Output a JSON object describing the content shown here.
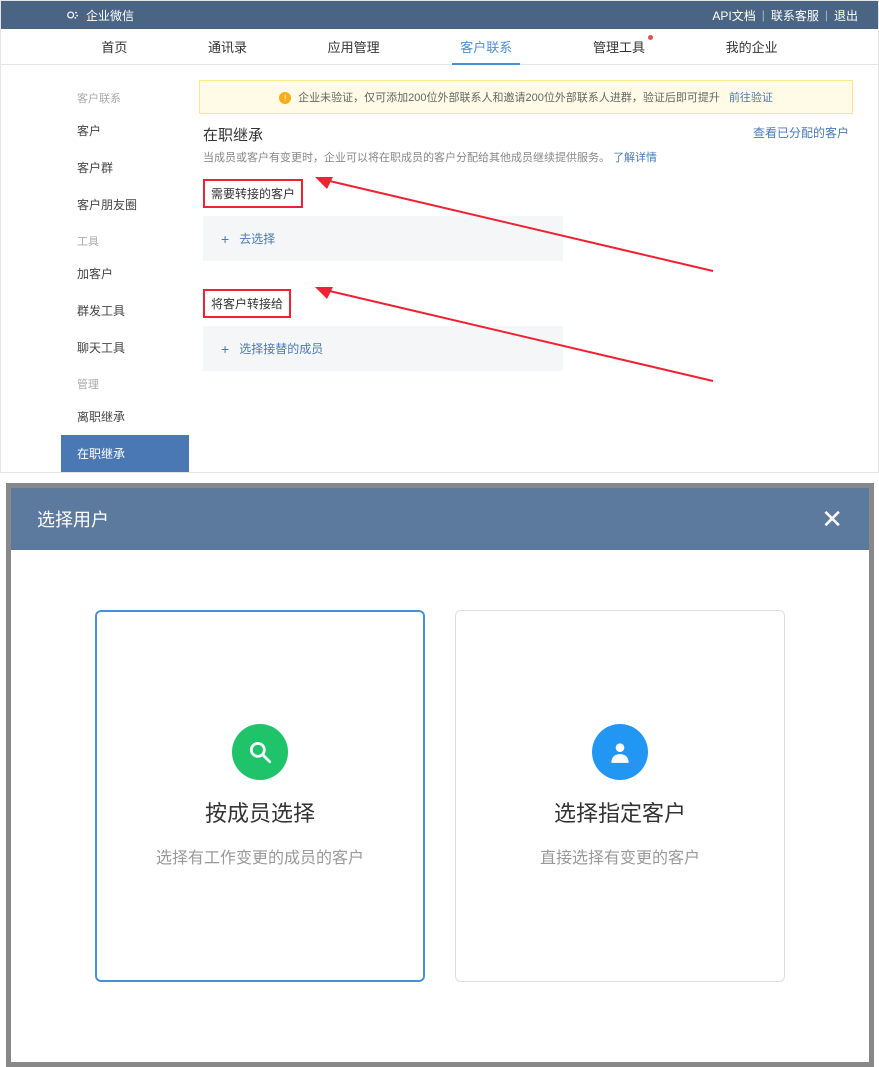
{
  "header": {
    "brand": "企业微信",
    "links": [
      "API文档",
      "联系客服",
      "退出"
    ]
  },
  "nav": {
    "items": [
      "首页",
      "通讯录",
      "应用管理",
      "客户联系",
      "管理工具",
      "我的企业"
    ],
    "active_index": 3,
    "dot_index": 4
  },
  "alert": {
    "text": "企业未验证，仅可添加200位外部联系人和邀请200位外部联系人进群，验证后即可提升",
    "link": "前往验证"
  },
  "sidebar": {
    "groups": [
      {
        "title": "客户联系",
        "items": [
          "客户",
          "客户群",
          "客户朋友圈"
        ]
      },
      {
        "title": "工具",
        "items": [
          "加客户",
          "群发工具",
          "聊天工具"
        ]
      },
      {
        "title": "管理",
        "items": [
          "离职继承",
          "在职继承"
        ]
      }
    ],
    "active": "在职继承"
  },
  "main": {
    "title": "在职继承",
    "desc_prefix": "当成员或客户有变更时，企业可以将在职成员的客户分配给其他成员继续提供服务。",
    "desc_link": "了解详情",
    "right_link": "查看已分配的客户",
    "section1_label": "需要转接的客户",
    "section1_action": "去选择",
    "section2_label": "将客户转接给",
    "section2_action": "选择接替的成员"
  },
  "dialog": {
    "title": "选择用户",
    "cards": [
      {
        "title": "按成员选择",
        "desc": "选择有工作变更的成员的客户"
      },
      {
        "title": "选择指定客户",
        "desc": "直接选择有变更的客户"
      }
    ]
  }
}
